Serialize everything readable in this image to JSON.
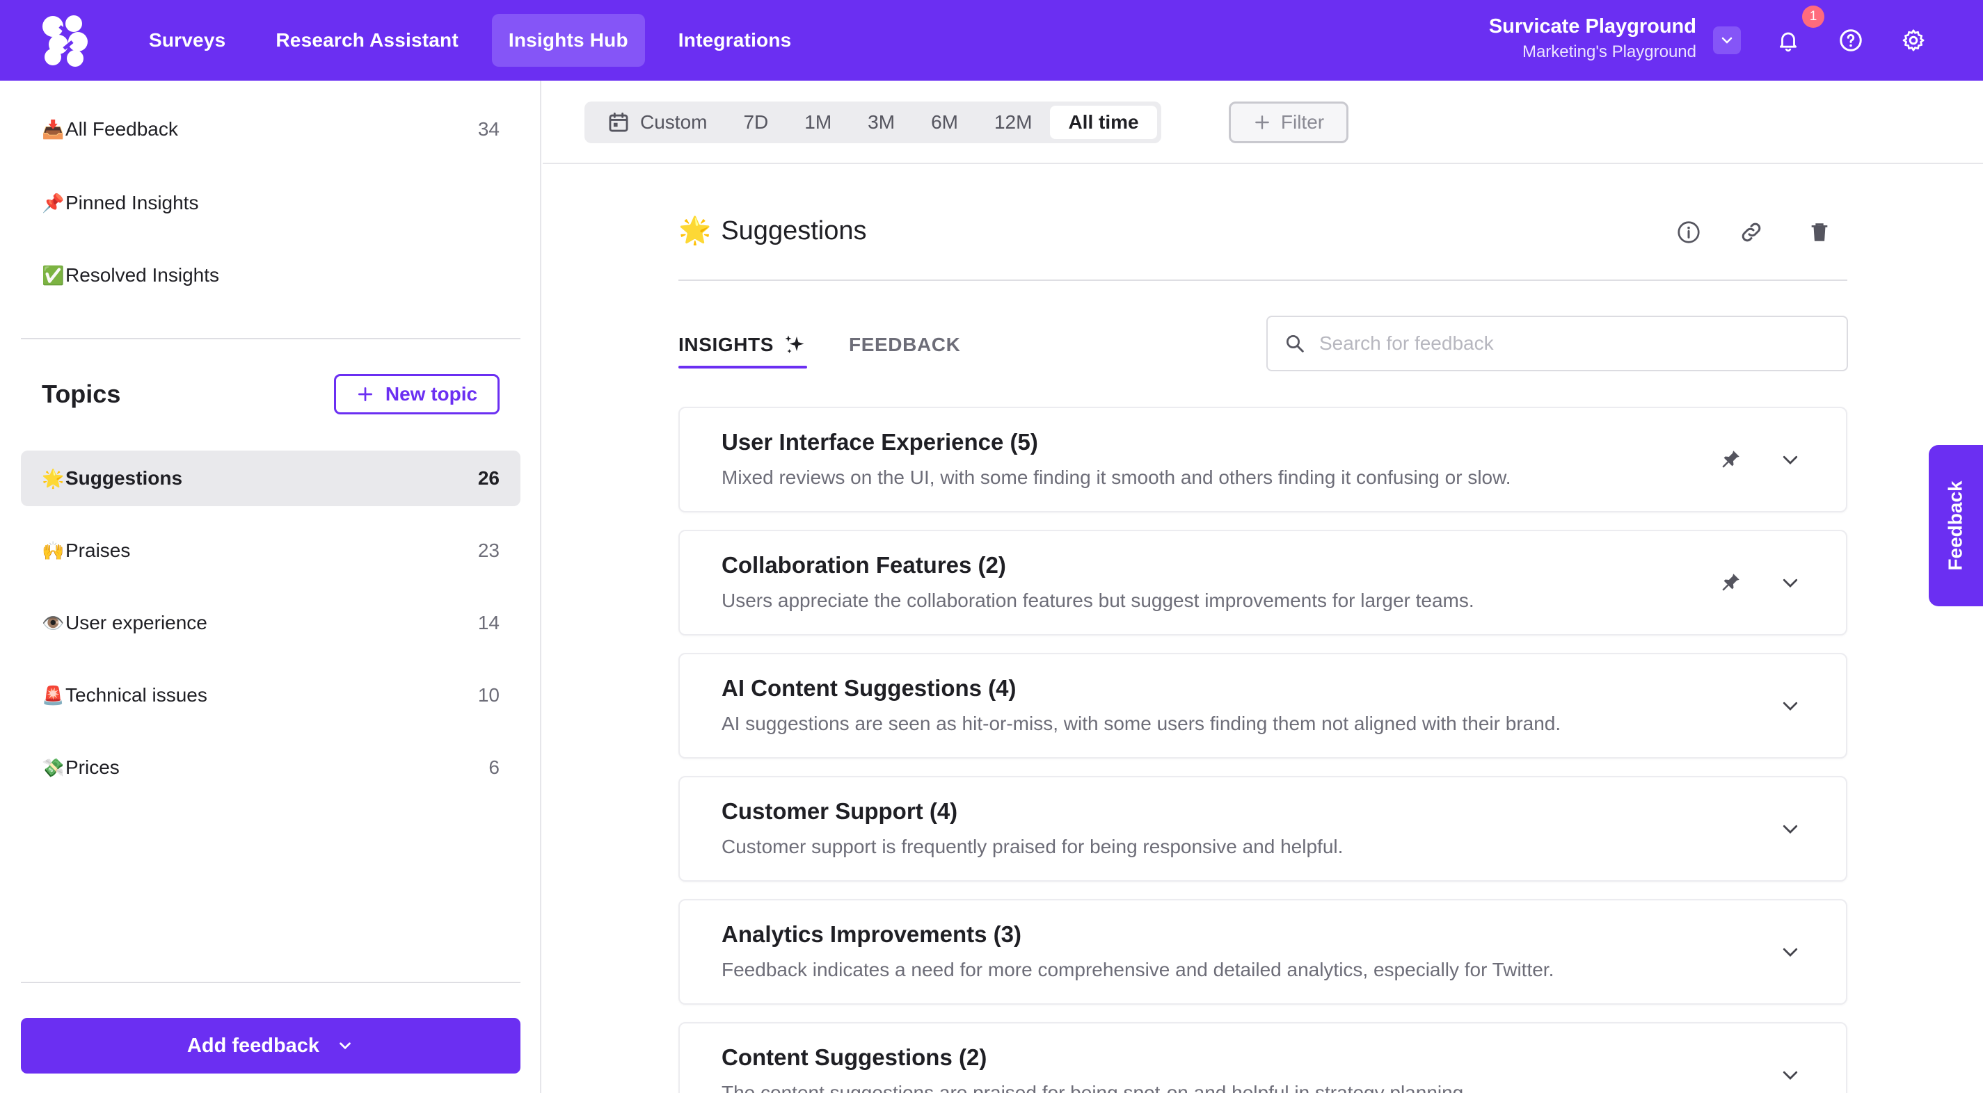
{
  "nav": {
    "items": [
      "Surveys",
      "Research Assistant",
      "Insights Hub",
      "Integrations"
    ],
    "active": "Insights Hub",
    "workspace_name": "Survicate Playground",
    "workspace_sub": "Marketing's Playground",
    "notification_count": "1",
    "icons": [
      "chevron-down-icon",
      "bell-icon",
      "help-icon",
      "gear-icon"
    ]
  },
  "sidebar": {
    "top_items": [
      {
        "emoji": "📥",
        "label": "All Feedback",
        "count": "34"
      },
      {
        "emoji": "📌",
        "label": "Pinned Insights",
        "count": ""
      },
      {
        "emoji": "✅",
        "label": "Resolved Insights",
        "count": ""
      }
    ],
    "topics_title": "Topics",
    "new_topic_label": "New topic",
    "topics": [
      {
        "emoji": "🌟",
        "label": "Suggestions",
        "count": "26",
        "active": true
      },
      {
        "emoji": "🙌",
        "label": "Praises",
        "count": "23"
      },
      {
        "emoji": "👁️",
        "label": "User experience",
        "count": "14"
      },
      {
        "emoji": "🚨",
        "label": "Technical issues",
        "count": "10"
      },
      {
        "emoji": "💸",
        "label": "Prices",
        "count": "6"
      }
    ],
    "add_feedback_label": "Add feedback"
  },
  "filters": {
    "ranges": [
      "Custom",
      "7D",
      "1M",
      "3M",
      "6M",
      "12M",
      "All time"
    ],
    "active_range": "All time",
    "filter_label": "Filter"
  },
  "topic": {
    "emoji": "🌟",
    "title": "Suggestions",
    "tabs": [
      "INSIGHTS",
      "FEEDBACK"
    ],
    "active_tab": "INSIGHTS",
    "search_placeholder": "Search for feedback"
  },
  "insights": [
    {
      "title": "User Interface Experience (5)",
      "desc": "Mixed reviews on the UI, with some finding it smooth and others finding it confusing or slow.",
      "pinned": true
    },
    {
      "title": "Collaboration Features (2)",
      "desc": "Users appreciate the collaboration features but suggest improvements for larger teams.",
      "pinned": true
    },
    {
      "title": "AI Content Suggestions (4)",
      "desc": "AI suggestions are seen as hit-or-miss, with some users finding them not aligned with their brand.",
      "pinned": false
    },
    {
      "title": "Customer Support (4)",
      "desc": "Customer support is frequently praised for being responsive and helpful.",
      "pinned": false
    },
    {
      "title": "Analytics Improvements (3)",
      "desc": "Feedback indicates a need for more comprehensive and detailed analytics, especially for Twitter.",
      "pinned": false
    },
    {
      "title": "Content Suggestions (2)",
      "desc": "The content suggestions are praised for being spot-on and helpful in strategy planning.",
      "pinned": false
    }
  ],
  "feedback_tab_label": "Feedback",
  "colors": {
    "brand": "#6b2ff2",
    "nav_active": "#8555f7",
    "badge": "#ff6b7d"
  }
}
